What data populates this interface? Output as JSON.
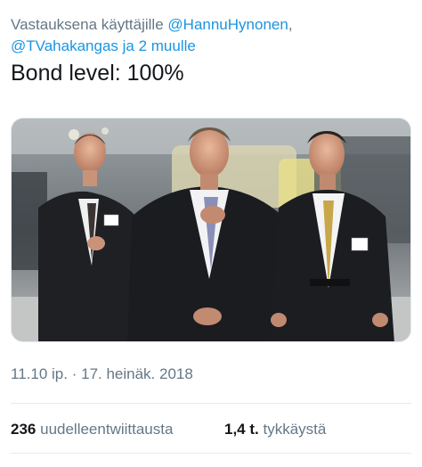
{
  "reply": {
    "prefix": "Vastauksena käyttäjille",
    "mention1": "@HannuHynonen",
    "separator": ",",
    "mention2": "@TVahakangas",
    "suffix": "ja 2 muulle"
  },
  "tweet": {
    "text": "Bond level: 100%"
  },
  "media": {
    "description_icon": "photo-image"
  },
  "meta": {
    "time": "11.10 ip.",
    "dot": "·",
    "date": "17. heinäk. 2018"
  },
  "stats": {
    "retweets_count": "236",
    "retweets_label": "uudelleentwiittausta",
    "likes_count": "1,4 t.",
    "likes_label": "tykkäystä"
  },
  "colors": {
    "link": "#1b95e0",
    "secondary_text": "#657786",
    "primary_text": "#14171a",
    "divider": "#e6ecf0"
  }
}
